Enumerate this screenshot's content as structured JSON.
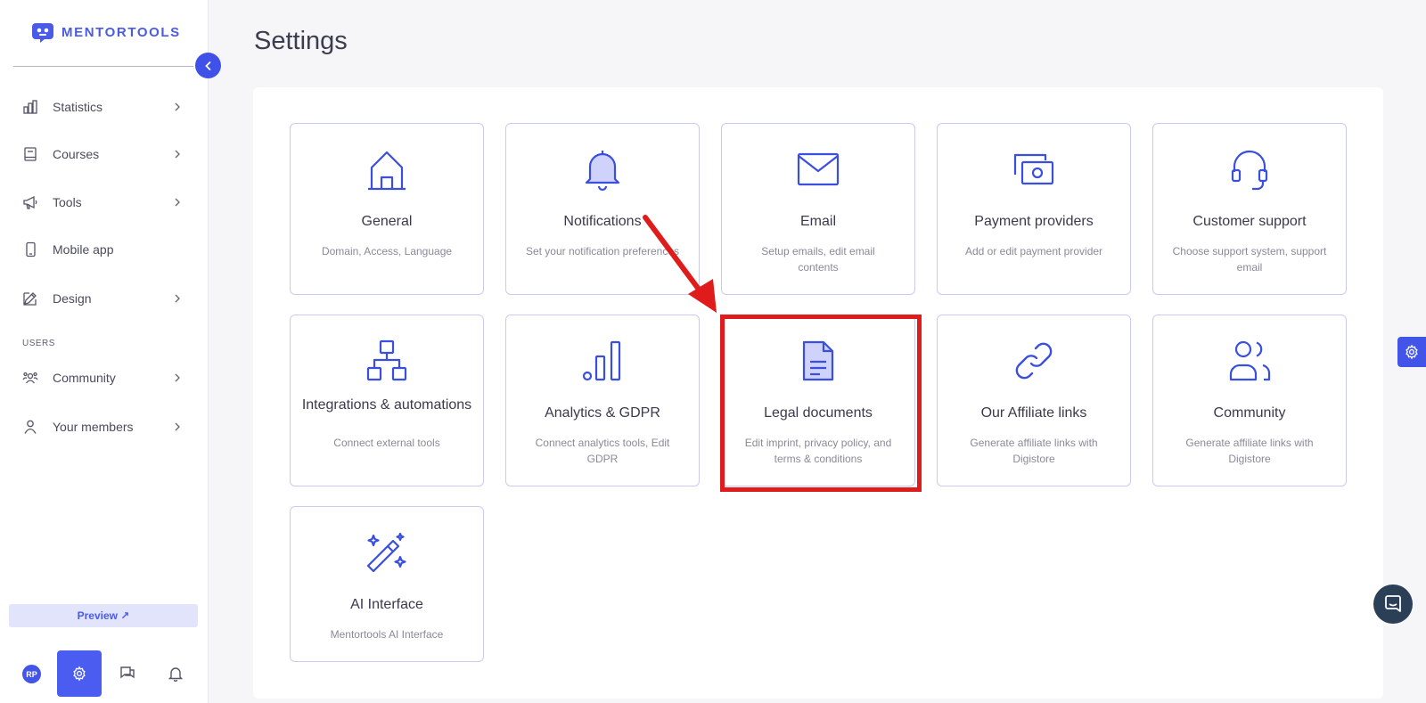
{
  "brand": {
    "name": "MENTORTOOLS"
  },
  "sidebar": {
    "items": [
      {
        "label": "Statistics",
        "icon": "bar-chart-icon",
        "has_chevron": true
      },
      {
        "label": "Courses",
        "icon": "book-icon",
        "has_chevron": true
      },
      {
        "label": "Tools",
        "icon": "megaphone-icon",
        "has_chevron": true
      },
      {
        "label": "Mobile app",
        "icon": "phone-icon",
        "has_chevron": false
      },
      {
        "label": "Design",
        "icon": "pencil-icon",
        "has_chevron": true
      }
    ],
    "section_users": "USERS",
    "user_items": [
      {
        "label": "Community",
        "icon": "people-icon",
        "has_chevron": true
      },
      {
        "label": "Your members",
        "icon": "user-icon",
        "has_chevron": true
      }
    ],
    "preview_label": "Preview ↗",
    "avatar_initials": "RP"
  },
  "page": {
    "title": "Settings"
  },
  "cards": [
    {
      "title": "General",
      "desc": "Domain, Access, Language",
      "icon": "home-icon"
    },
    {
      "title": "Notifications",
      "desc": "Set your notification preferences",
      "icon": "bell-icon"
    },
    {
      "title": "Email",
      "desc": "Setup emails, edit email contents",
      "icon": "envelope-icon"
    },
    {
      "title": "Payment providers",
      "desc": "Add or edit payment provider",
      "icon": "money-icon"
    },
    {
      "title": "Customer support",
      "desc": "Choose support system, support email",
      "icon": "headset-icon"
    },
    {
      "title": "Integrations & automations",
      "desc": "Connect external tools",
      "icon": "hierarchy-icon"
    },
    {
      "title": "Analytics & GDPR",
      "desc": "Connect analytics tools, Edit GDPR",
      "icon": "analytics-icon"
    },
    {
      "title": "Legal documents",
      "desc": "Edit imprint, privacy policy, and terms & conditions",
      "icon": "document-icon"
    },
    {
      "title": "Our Affiliate links",
      "desc": "Generate affiliate links with Digistore",
      "icon": "link-icon"
    },
    {
      "title": "Community",
      "desc": "Generate affiliate links with Digistore",
      "icon": "users-icon"
    },
    {
      "title": "AI Interface",
      "desc": "Mentortools AI Interface",
      "icon": "magic-wand-icon"
    }
  ],
  "colors": {
    "accent": "#4255e8",
    "highlight": "#e01b1b",
    "card_border": "#c9cbf3"
  }
}
